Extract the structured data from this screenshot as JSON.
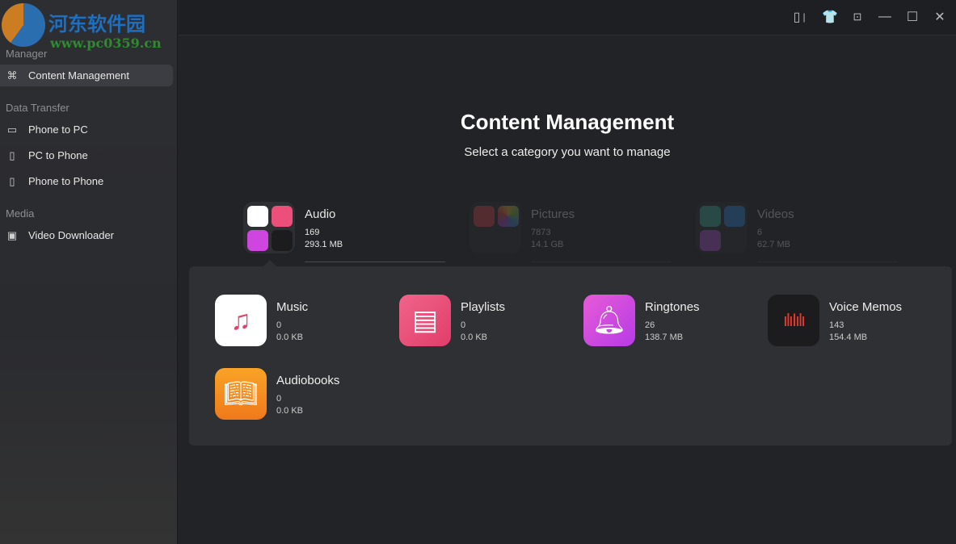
{
  "watermark": {
    "text": "河东软件园",
    "url": "www.pc0359.cn"
  },
  "sidebar": {
    "sections": [
      {
        "label": "Manager"
      },
      {
        "label": "Data Transfer"
      },
      {
        "label": "Media"
      }
    ],
    "items": [
      {
        "label": "Content Management",
        "icon": "grid-icon",
        "active": true
      },
      {
        "label": "Phone to PC",
        "icon": "monitor-icon"
      },
      {
        "label": "PC to Phone",
        "icon": "phone-plus-icon"
      },
      {
        "label": "Phone to Phone",
        "icon": "phones-icon"
      },
      {
        "label": "Video Downloader",
        "icon": "download-video-icon"
      }
    ]
  },
  "window_controls": [
    "device-icon",
    "tshirt-icon",
    "dropdown-menu-icon",
    "minimize-icon",
    "maximize-icon",
    "close-icon"
  ],
  "main": {
    "title": "Content Management",
    "subtitle": "Select a category you want to manage",
    "categories": [
      {
        "name": "Audio",
        "count": "169",
        "size": "293.1 MB",
        "selected": true
      },
      {
        "name": "Pictures",
        "count": "7873",
        "size": "14.1 GB"
      },
      {
        "name": "Videos",
        "count": "6",
        "size": "62.7 MB"
      }
    ],
    "subcategories": [
      {
        "name": "Music",
        "count": "0",
        "size": "0.0 KB",
        "color": "#ffffff"
      },
      {
        "name": "Playlists",
        "count": "0",
        "size": "0.0 KB",
        "color": "#ec4f7a"
      },
      {
        "name": "Ringtones",
        "count": "26",
        "size": "138.7 MB",
        "color": "#cf45e0"
      },
      {
        "name": "Voice Memos",
        "count": "143",
        "size": "154.4 MB",
        "color": "#1c1c1e"
      },
      {
        "name": "Audiobooks",
        "count": "0",
        "size": "0.0 KB",
        "color": "#f3901e"
      }
    ]
  }
}
